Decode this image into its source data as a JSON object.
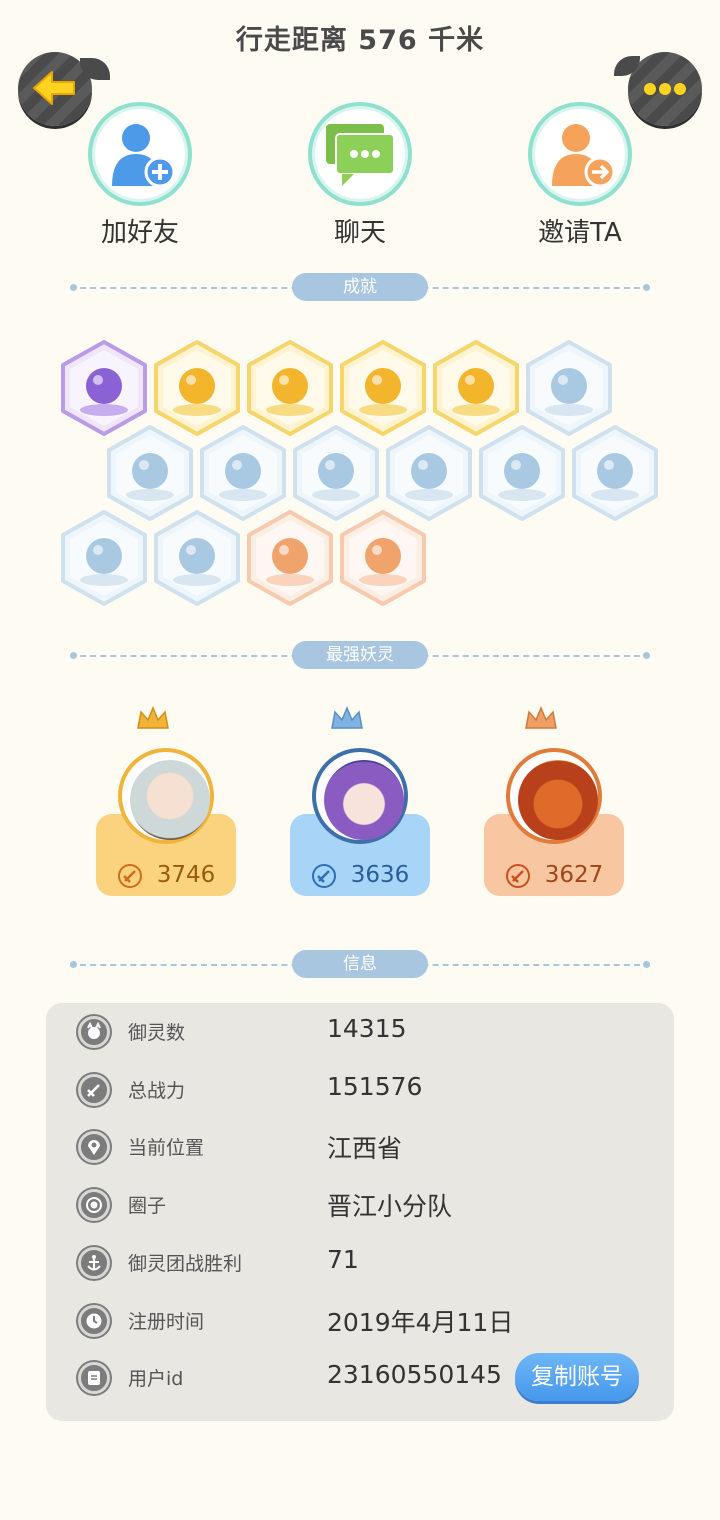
{
  "header": {
    "title": "行走距离 576 千米"
  },
  "nav": {
    "back_icon": "arrow-left-icon",
    "more_icon": "ellipsis-icon"
  },
  "actions": [
    {
      "label": "加好友",
      "icon": "add-friend-icon"
    },
    {
      "label": "聊天",
      "icon": "chat-bubble-icon"
    },
    {
      "label": "邀请TA",
      "icon": "invite-icon"
    }
  ],
  "sections": {
    "achievements": "成就",
    "strongest": "最强妖灵",
    "info": "信息"
  },
  "achievements": [
    {
      "icon": "purple-devil-badge-icon",
      "tier": "purple"
    },
    {
      "icon": "sun-orb-badge-icon",
      "tier": "gold"
    },
    {
      "icon": "golden-pearl-badge-icon",
      "tier": "gold"
    },
    {
      "icon": "flaming-yinyang-badge-icon",
      "tier": "gold"
    },
    {
      "icon": "yinyang-scroll-badge-icon",
      "tier": "gold"
    },
    {
      "icon": "sneaker-badge-icon",
      "tier": "blue"
    },
    {
      "icon": "moon-badge-icon",
      "tier": "blue"
    },
    {
      "icon": "crystal-badge-icon",
      "tier": "blue"
    },
    {
      "icon": "spirit-figure-badge-icon",
      "tier": "blue"
    },
    {
      "icon": "cat-cart-badge-icon",
      "tier": "blue"
    },
    {
      "icon": "cat-balloon-badge-icon",
      "tier": "blue"
    },
    {
      "icon": "eye-banner-badge-icon",
      "tier": "blue"
    },
    {
      "icon": "cat-silhouette-badge-icon",
      "tier": "blue"
    },
    {
      "icon": "fox-book-badge-icon",
      "tier": "blue"
    },
    {
      "icon": "koi-fish-badge-icon",
      "tier": "orange"
    },
    {
      "icon": "horned-beast-badge-icon",
      "tier": "orange"
    }
  ],
  "strongest_spirits": [
    {
      "power": "3746",
      "color": "#fbd37f",
      "crown": "#f0b43a"
    },
    {
      "power": "3636",
      "color": "#a8d4f8",
      "crown": "#7fb3e3"
    },
    {
      "power": "3627",
      "color": "#f8c6a0",
      "crown": "#f0a066"
    }
  ],
  "info": {
    "rows": [
      {
        "key": "御灵数",
        "value": "14315",
        "icon": "spirit-count-icon"
      },
      {
        "key": "总战力",
        "value": "151576",
        "icon": "sword-icon"
      },
      {
        "key": "当前位置",
        "value": "江西省",
        "icon": "location-pin-icon"
      },
      {
        "key": "圈子",
        "value": "晋江小分队",
        "icon": "circle-group-icon"
      },
      {
        "key": "御灵团战胜利",
        "value": "71",
        "icon": "anchor-icon"
      },
      {
        "key": "注册时间",
        "value": "2019年4月11日",
        "icon": "clock-icon"
      },
      {
        "key": "用户id",
        "value": "23160550145",
        "icon": "id-card-icon"
      }
    ],
    "copy_button": "复制账号"
  },
  "colors": {
    "accent_blue": "#4698ec",
    "divider": "#a8c6e0",
    "background": "#fdfbf2"
  }
}
